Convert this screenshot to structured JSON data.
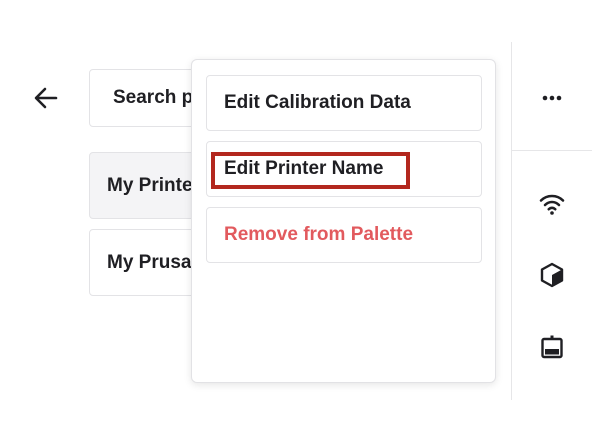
{
  "search": {
    "visible_text": "Search p"
  },
  "printers": [
    {
      "label": "My Printe",
      "selected": true
    },
    {
      "label": "My Prusa",
      "selected": false
    }
  ],
  "menu": {
    "items": [
      {
        "label": "Edit Calibration Data",
        "style": "normal"
      },
      {
        "label": "Edit Printer Name",
        "style": "normal",
        "highlighted": true
      },
      {
        "label": "Remove from Palette",
        "style": "danger"
      }
    ]
  },
  "icons": {
    "back": "arrow-left-icon",
    "more": "more-horizontal-icon",
    "wifi": "wifi-icon",
    "cube": "cube-icon",
    "device": "device-icon"
  },
  "colors": {
    "text": "#1f1f23",
    "danger": "#e25a5e",
    "highlight": "#b3271e",
    "border": "#e3e3e6",
    "selected_bg": "#f4f4f6"
  }
}
